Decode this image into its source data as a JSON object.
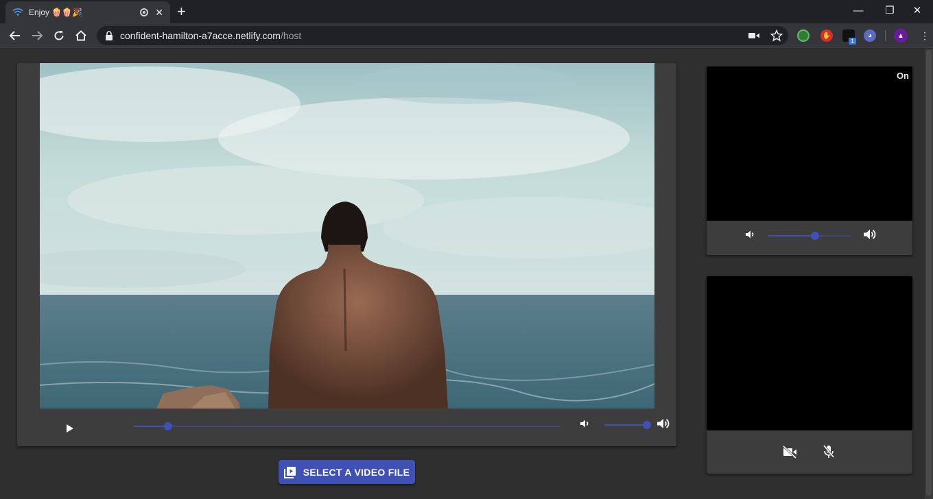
{
  "browser": {
    "tab_title": "Enjoy 🍿🍿🎉",
    "url_host": "confident-hamilton-a7acce.netlify.com",
    "url_path": "/host",
    "new_tab_symbol": "+",
    "tab_close_symbol": "✕",
    "window_controls": {
      "minimize": "—",
      "restore": "❐",
      "close": "✕"
    },
    "extension_badge": "1"
  },
  "player": {
    "playback_progress": 0.08,
    "volume_level": 1.0
  },
  "select_button": {
    "label": "SELECT A VIDEO FILE"
  },
  "remote_cam": {
    "status_label": "On",
    "volume_level": 0.57
  },
  "local_cam": {
    "camera": "off",
    "microphone": "off"
  },
  "colors": {
    "accent": "#3f51b5",
    "page_bg": "#2f2f2f",
    "panel_bg": "#3d3d3d",
    "browser_frame": "#202124"
  }
}
